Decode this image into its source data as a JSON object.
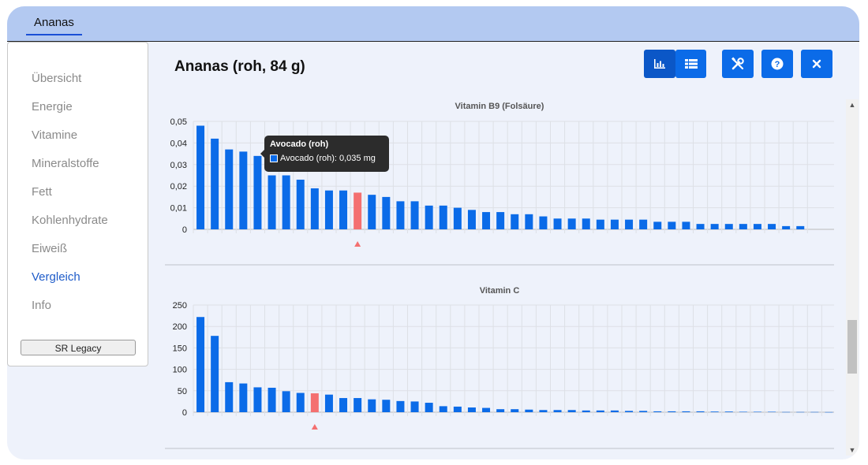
{
  "app": {
    "tab": "Ananas"
  },
  "sidebar": {
    "items": [
      {
        "label": "Übersicht",
        "active": false
      },
      {
        "label": "Energie",
        "active": false
      },
      {
        "label": "Vitamine",
        "active": false
      },
      {
        "label": "Mineralstoffe",
        "active": false
      },
      {
        "label": "Fett",
        "active": false
      },
      {
        "label": "Kohlenhydrate",
        "active": false
      },
      {
        "label": "Eiweiß",
        "active": false
      },
      {
        "label": "Vergleich",
        "active": true
      },
      {
        "label": "Info",
        "active": false
      }
    ],
    "source_button": "SR Legacy"
  },
  "header": {
    "title": "Ananas (roh, 84 g)",
    "icons": [
      "bar-chart-icon",
      "table-list-icon",
      "tools-icon",
      "help-icon",
      "close-icon"
    ]
  },
  "colors": {
    "bar": "#0b6be8",
    "highlight": "#f47070",
    "accent": "#0b6be8"
  },
  "tooltip": {
    "title": "Avocado (roh)",
    "text": "Avocado (roh): 0,035 mg"
  },
  "chart_data": [
    {
      "type": "bar",
      "title": "Vitamin B9 (Folsäure)",
      "ylim": [
        0,
        0.05
      ],
      "yticks": [
        "0",
        "0,01",
        "0,02",
        "0,03",
        "0,04",
        "0,05"
      ],
      "highlight_index": 11,
      "values": [
        0.048,
        0.042,
        0.037,
        0.036,
        0.034,
        0.025,
        0.025,
        0.023,
        0.019,
        0.018,
        0.018,
        0.017,
        0.016,
        0.015,
        0.013,
        0.013,
        0.011,
        0.011,
        0.01,
        0.009,
        0.008,
        0.008,
        0.007,
        0.007,
        0.006,
        0.005,
        0.005,
        0.005,
        0.0045,
        0.0045,
        0.0045,
        0.0045,
        0.0035,
        0.0035,
        0.0035,
        0.0025,
        0.0025,
        0.0025,
        0.0025,
        0.0025,
        0.0025,
        0.0015,
        0.0015
      ]
    },
    {
      "type": "bar",
      "title": "Vitamin C",
      "ylim": [
        0,
        250
      ],
      "yticks": [
        "0",
        "50",
        "100",
        "150",
        "200",
        "250"
      ],
      "highlight_index": 8,
      "values": [
        222,
        178,
        70,
        67,
        58,
        57,
        49,
        45,
        44,
        41,
        33,
        33,
        30,
        29,
        26,
        25,
        22,
        14,
        13,
        11,
        10,
        7,
        7,
        6,
        5,
        5,
        5,
        4,
        4,
        4,
        3,
        3,
        2,
        2,
        2,
        2,
        1.5,
        1.5,
        1,
        1,
        1,
        0.5,
        0.5,
        0.5,
        0.3
      ]
    }
  ]
}
